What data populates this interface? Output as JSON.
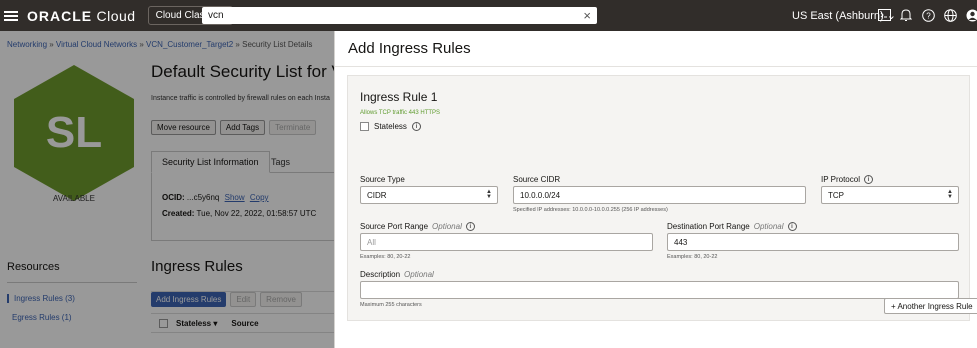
{
  "topbar": {
    "brand_bold": "ORACLE",
    "brand_rest": " Cloud",
    "classic_label": "Cloud Classic",
    "search_value": "vcn",
    "region_label": "US East (Ashburn)"
  },
  "page": {
    "breadcrumb": {
      "networking": "Networking",
      "vcns": "Virtual Cloud Networks",
      "vcn_name": "VCN_Customer_Target2",
      "current": "Security List Details",
      "sep": " » "
    },
    "hex_label": "SL",
    "status": "AVAILABLE",
    "title": "Default Security List for VCN",
    "description": "Instance traffic is controlled by firewall rules on each Insta",
    "buttons": {
      "move": "Move resource",
      "tags": "Add Tags",
      "terminate": "Terminate"
    },
    "tabs": {
      "info": "Security List Information",
      "tags": "Tags"
    },
    "info": {
      "ocid_label": "OCID:",
      "ocid_value": "...c5y6nq",
      "show": "Show",
      "copy": "Copy",
      "created_label": "Created:",
      "created_value": "Tue, Nov 22, 2022, 01:58:57 UTC"
    },
    "resources": {
      "title": "Resources",
      "ingress": "Ingress Rules (3)",
      "egress": "Egress Rules (1)"
    },
    "ingress": {
      "title": "Ingress Rules",
      "add": "Add Ingress Rules",
      "edit": "Edit",
      "remove": "Remove",
      "col_stateless": "Stateless",
      "col_source": "Source"
    }
  },
  "drawer": {
    "title": "Add Ingress Rules",
    "rule_title": "Ingress Rule 1",
    "allows": "Allows TCP traffic 443 HTTPS",
    "stateless_label": "Stateless",
    "source_type": {
      "label": "Source Type",
      "value": "CIDR"
    },
    "source_cidr": {
      "label": "Source CIDR",
      "value": "10.0.0.0/24",
      "hint": "Specified IP addresses: 10.0.0.0-10.0.0.255 (256 IP addresses)"
    },
    "ip_protocol": {
      "label": "IP Protocol",
      "value": "TCP"
    },
    "source_port": {
      "label": "Source Port Range",
      "optional": "Optional",
      "placeholder": "All",
      "hint": "Examples: 80, 20-22"
    },
    "dest_port": {
      "label": "Destination Port Range",
      "optional": "Optional",
      "value": "443",
      "hint": "Examples: 80, 20-22"
    },
    "description": {
      "label": "Description",
      "optional": "Optional",
      "value": "",
      "hint": "Maximum 255 characters"
    },
    "another_rule": "+ Another Ingress Rule"
  }
}
